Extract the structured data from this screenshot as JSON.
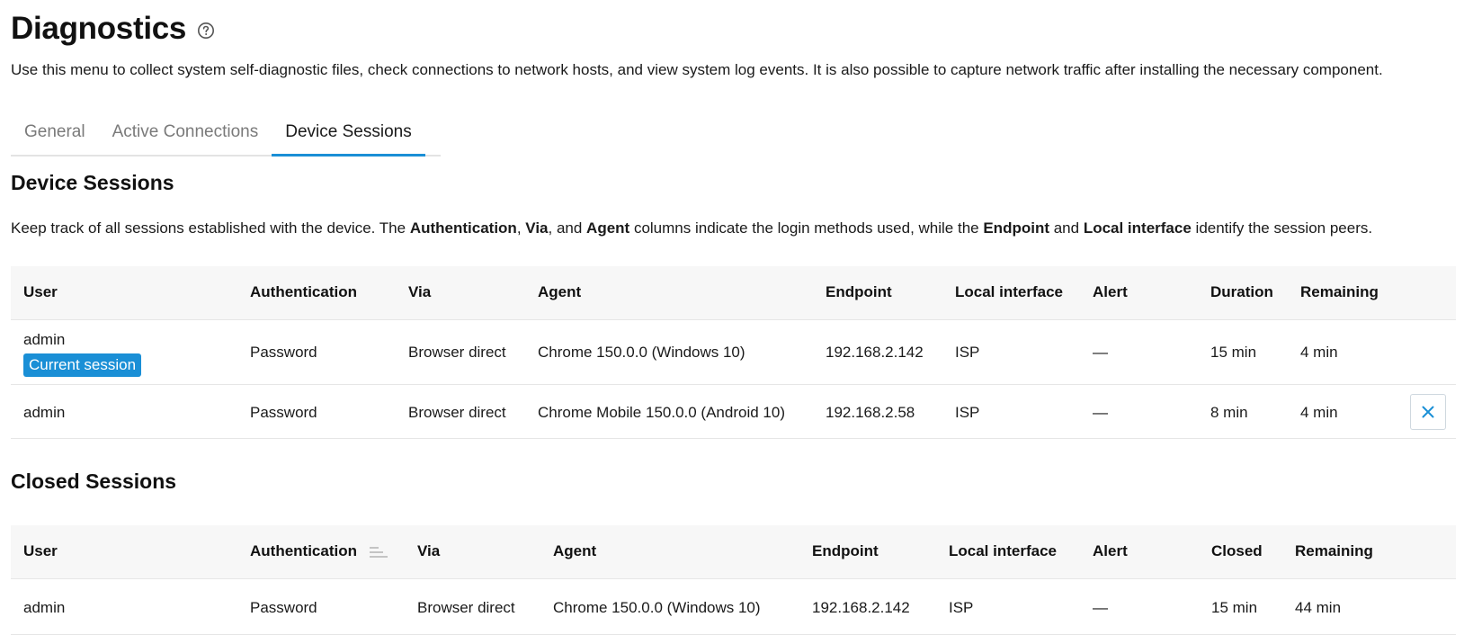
{
  "page": {
    "title": "Diagnostics",
    "intro": "Use this menu to collect system self-diagnostic files, check connections to network hosts, and view system log events. It is also possible to capture network traffic after installing the necessary component."
  },
  "tabs": [
    {
      "label": "General",
      "active": false
    },
    {
      "label": "Active Connections",
      "active": false
    },
    {
      "label": "Device Sessions",
      "active": true
    }
  ],
  "device_sessions": {
    "title": "Device Sessions",
    "desc_parts": {
      "p1": "Keep track of all sessions established with the device. The ",
      "b1": "Authentication",
      "p2": ", ",
      "b2": "Via",
      "p3": ", and ",
      "b3": "Agent",
      "p4": " columns indicate the login methods used, while the ",
      "b4": "Endpoint",
      "p5": " and ",
      "b5": "Local interface",
      "p6": " identify the session peers."
    },
    "columns": [
      "User",
      "Authentication",
      "Via",
      "Agent",
      "Endpoint",
      "Local interface",
      "Alert",
      "Duration",
      "Remaining"
    ],
    "rows": [
      {
        "user": "admin",
        "badge": "Current session",
        "auth": "Password",
        "via": "Browser direct",
        "agent": "Chrome 150.0.0 (Windows 10)",
        "endpoint": "192.168.2.142",
        "iface": "ISP",
        "alert": "—",
        "duration": "15 min",
        "remaining": "4 min"
      },
      {
        "user": "admin",
        "auth": "Password",
        "via": "Browser direct",
        "agent": "Chrome Mobile 150.0.0 (Android 10)",
        "endpoint": "192.168.2.58",
        "iface": "ISP",
        "alert": "—",
        "duration": "8 min",
        "remaining": "4 min"
      }
    ]
  },
  "closed_sessions": {
    "title": "Closed Sessions",
    "columns": [
      "User",
      "Authentication",
      "Via",
      "Agent",
      "Endpoint",
      "Local interface",
      "Alert",
      "Closed",
      "Remaining"
    ],
    "rows": [
      {
        "user": "admin",
        "auth": "Password",
        "via": "Browser direct",
        "agent": "Chrome 150.0.0 (Windows 10)",
        "endpoint": "192.168.2.142",
        "iface": "ISP",
        "alert": "—",
        "closed": "15 min",
        "remaining": "44 min"
      }
    ]
  },
  "icons": {
    "help": "help-circle-icon",
    "close": "close-icon",
    "sort": "sort-icon"
  },
  "colors": {
    "accent": "#1a8fd6",
    "header_bg": "#f7f7f7",
    "border": "#e6e6e6"
  }
}
